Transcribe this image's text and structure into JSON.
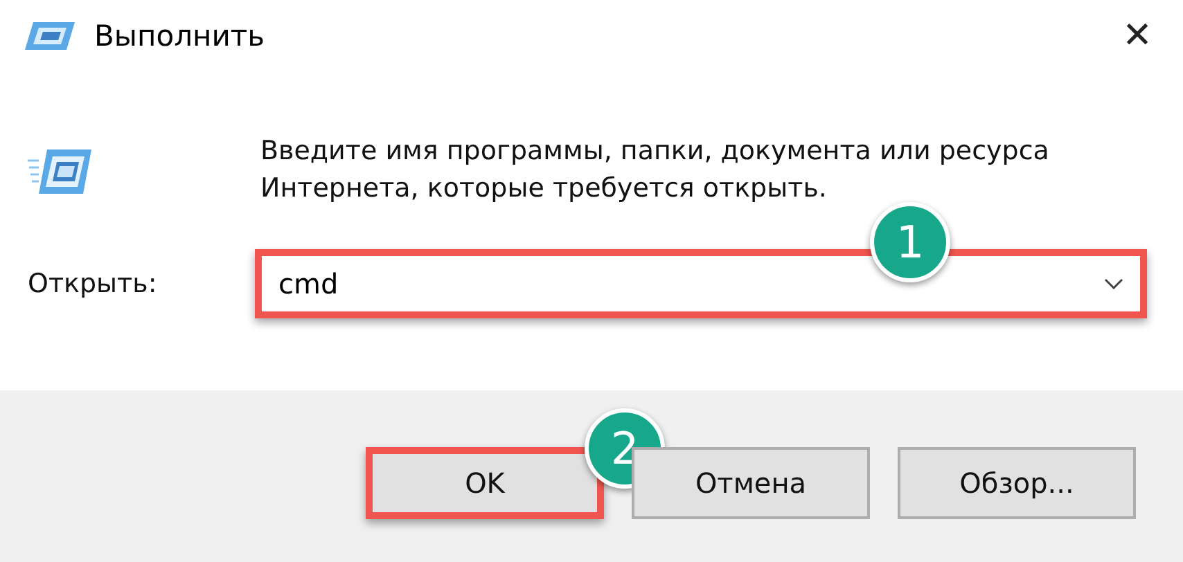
{
  "window": {
    "title": "Выполнить",
    "close": "✕"
  },
  "prompt": "Введите имя программы, папки, документа или ресурса Интернета, которые требуется открыть.",
  "open_field": {
    "label": "Открыть:",
    "value": "cmd",
    "highlighted": true,
    "callout": "1"
  },
  "buttons": [
    {
      "label": "OK",
      "highlighted": true,
      "callout": "2"
    },
    {
      "label": "Отмена",
      "highlighted": false
    },
    {
      "label": "Обзор...",
      "highlighted": false
    }
  ]
}
